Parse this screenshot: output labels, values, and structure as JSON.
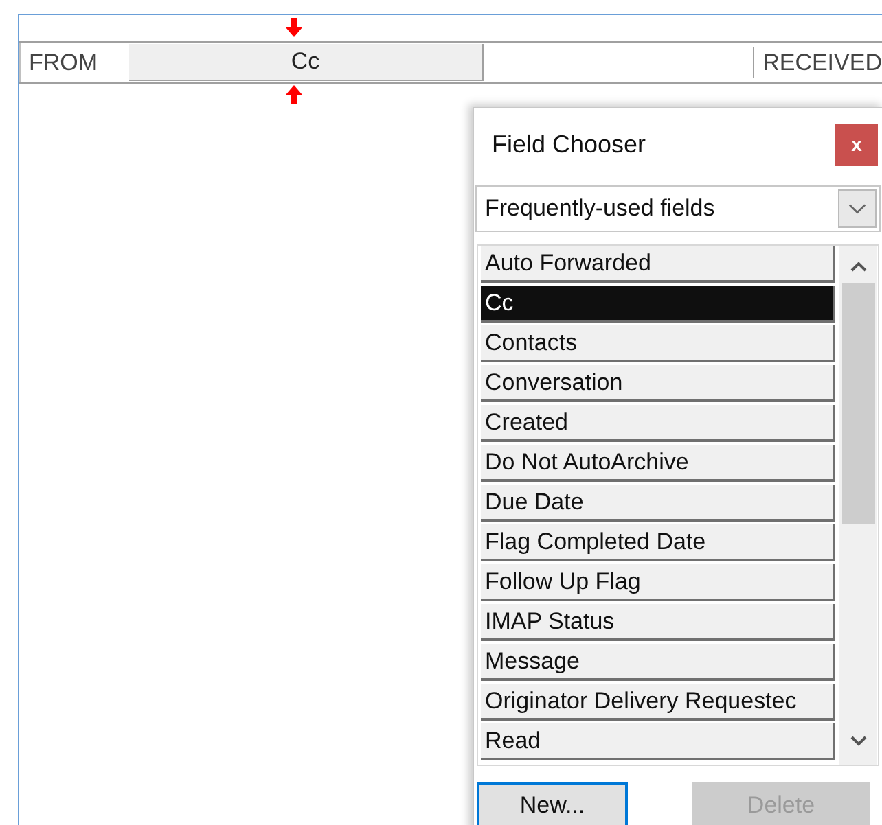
{
  "columns": [
    {
      "label": "FROM"
    },
    {
      "label": "Cc",
      "dragging": true
    },
    {
      "label": "RECEIVED"
    }
  ],
  "dialog": {
    "title": "Field Chooser",
    "close": "x",
    "category": "Frequently-used fields",
    "fields": [
      {
        "label": "Auto Forwarded",
        "selected": false
      },
      {
        "label": "Cc",
        "selected": true
      },
      {
        "label": "Contacts",
        "selected": false
      },
      {
        "label": "Conversation",
        "selected": false
      },
      {
        "label": "Created",
        "selected": false
      },
      {
        "label": "Do Not AutoArchive",
        "selected": false
      },
      {
        "label": "Due Date",
        "selected": false
      },
      {
        "label": "Flag Completed Date",
        "selected": false
      },
      {
        "label": "Follow Up Flag",
        "selected": false
      },
      {
        "label": "IMAP Status",
        "selected": false
      },
      {
        "label": "Message",
        "selected": false
      },
      {
        "label": "Originator Delivery Requestec",
        "selected": false
      },
      {
        "label": "Read",
        "selected": false
      }
    ],
    "buttons": [
      {
        "label": "New...",
        "disabled": false
      },
      {
        "label": "Delete",
        "disabled": true
      }
    ]
  }
}
